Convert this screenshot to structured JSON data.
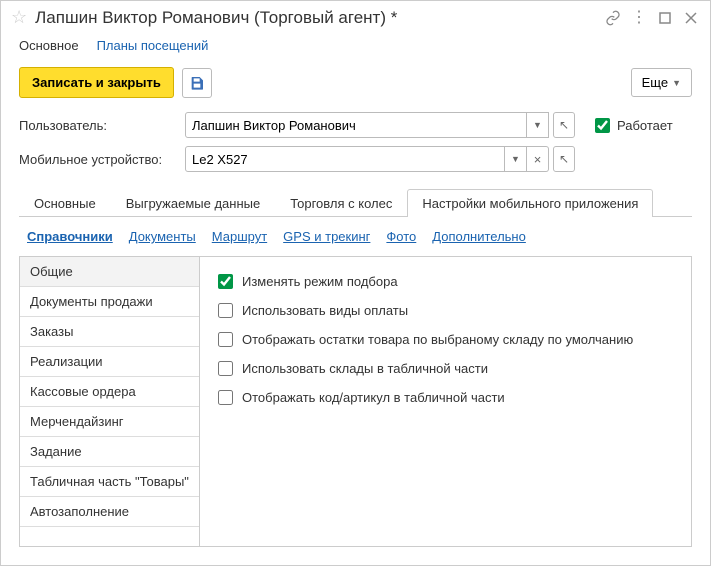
{
  "title": "Лапшин Виктор Романович (Торговый агент) *",
  "nav": {
    "current": "Основное",
    "plans": "Планы посещений"
  },
  "toolbar": {
    "save_close": "Записать и закрыть",
    "more": "Еще"
  },
  "fields": {
    "user_label": "Пользователь:",
    "user_value": "Лапшин Виктор Романович",
    "works_label": "Работает",
    "device_label": "Мобильное устройство:",
    "device_value": "Le2 X527"
  },
  "tabs": [
    "Основные",
    "Выгружаемые данные",
    "Торговля с колес",
    "Настройки мобильного приложения"
  ],
  "active_tab": 3,
  "subtabs": [
    "Справочники",
    "Документы",
    "Маршрут",
    "GPS и трекинг",
    "Фото",
    "Дополнительно"
  ],
  "active_subtab": 0,
  "sidemenu": [
    "Общие",
    "Документы продажи",
    "Заказы",
    "Реализации",
    "Кассовые ордера",
    "Мерчендайзинг",
    "Задание",
    "Табличная часть \"Товары\"",
    "Автозаполнение"
  ],
  "active_side": 0,
  "options": [
    {
      "label": "Изменять режим подбора",
      "checked": true
    },
    {
      "label": "Использовать виды оплаты",
      "checked": false
    },
    {
      "label": "Отображать остатки товара по выбраному складу по умолчанию",
      "checked": false
    },
    {
      "label": "Использовать склады в табличной части",
      "checked": false
    },
    {
      "label": "Отображать код/артикул в табличной части",
      "checked": false
    }
  ]
}
